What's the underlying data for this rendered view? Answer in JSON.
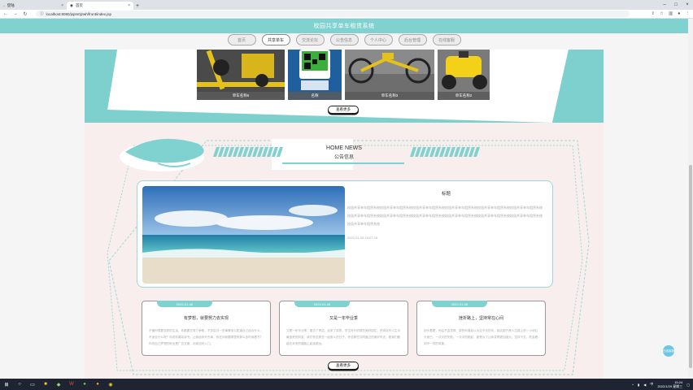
{
  "browser": {
    "tabs": [
      {
        "label": "登陆",
        "active": false
      },
      {
        "label": "首页",
        "active": true
      }
    ],
    "url": "localhost:8080/jspm0jzwh/front/index.jsp"
  },
  "header": {
    "title": "校园共享单车租赁系统"
  },
  "nav": {
    "items": [
      "首页",
      "共享单车",
      "交流论坛",
      "公告信息",
      "个人中心",
      "后台管理",
      "在线客服"
    ],
    "active_index": 1
  },
  "products": {
    "cards": [
      {
        "caption": "单车名称6"
      },
      {
        "caption": "名称"
      },
      {
        "caption": "单车名称3"
      },
      {
        "caption": "单车名称2"
      }
    ],
    "more_label": "查看更多"
  },
  "news": {
    "heading_en": "HOME NEWS",
    "heading_cn": "公告信息",
    "feature": {
      "title": "标题",
      "body": "校园共享单车租赁系统校园共享单车租赁系统校园共享单车租赁系统校园共享单车租赁系统校园共享单车租赁系统校园共享单车租赁系统校园共享单车租赁系统校园共享单车租赁系统校园共享单车租赁系统校园共享单车租赁系统校园共享单车租赁系统校园共享单车租赁系统校园共享单车租赁系统",
      "date": "2022-01-06 15:07:16"
    },
    "cards": [
      {
        "date": "2022-01-06",
        "title": "有梦想，就要努力去实现",
        "body": "不管你想要怎样的生活，你都要去努力争取，不多尝试一些事情怎么知道自己适合什么，不适合什么呢？你说你喜欢读书，让我给你列书单，你还问我要哪里有那么多时间看书？你说自己梦想的职业是广告文案，问我如何入门。"
      },
      {
        "date": "2022-01-06",
        "title": "又是一年毕业季",
        "body": "又是一年毕业季，褪去了青涩，迎来了成熟，学生时代的那些美好回忆，终将化作人生中最宝贵的财富，我们怀念那些一起奋斗的日子，怀念那些共同度过的美好时光，愿我们都能在未来的道路上越走越远。"
      },
      {
        "date": "2022-01-06",
        "title": "挫折路上，坚持常在心间",
        "body": "回头看看，你会不会觉得，那些你曾经以为过不去的坎，其实都只是人生路上的一小块石头而已，一次次的失败，一次次的爬起，都是为了让你变得更加强大，坚持下去，终会看到不一样的风景。"
      }
    ],
    "more_label": "查看更多"
  },
  "float_button": {
    "label": "在线客服"
  },
  "taskbar": {
    "time": "15:24",
    "date": "2022/1/29 星期三",
    "lang": "中"
  },
  "colors": {
    "accent": "#7fd2cf",
    "news_bg": "#f8eeee"
  }
}
